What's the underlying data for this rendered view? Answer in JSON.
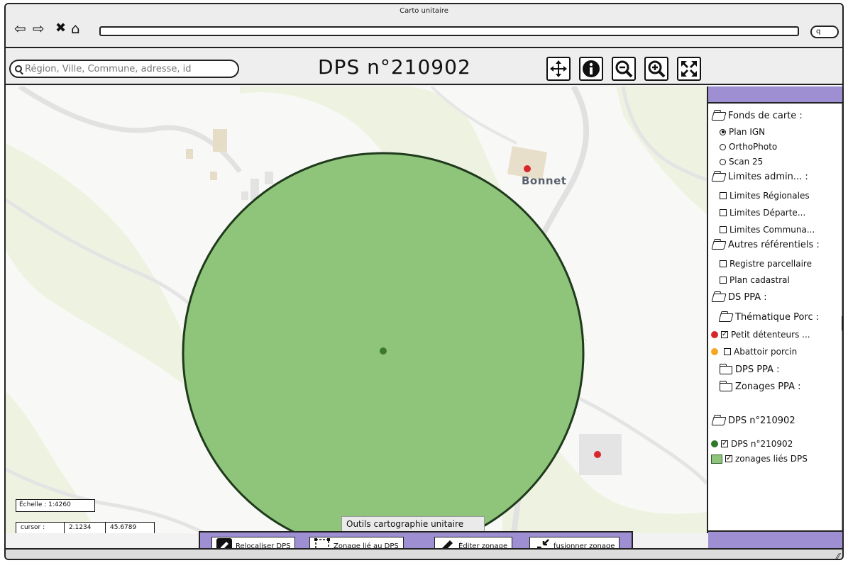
{
  "window": {
    "title": "Carto unitaire"
  },
  "browser": {
    "nav_icons": [
      "back-icon",
      "forward-icon",
      "close-icon",
      "home-icon"
    ],
    "search_glyph": "q"
  },
  "toolbar": {
    "search_placeholder": "Région, Ville, Commune, adresse, id",
    "page_title": "DPS n°210902",
    "tools": [
      "pan-icon",
      "info-icon",
      "zoom-out-icon",
      "zoom-in-icon",
      "fullscreen-icon"
    ]
  },
  "map": {
    "place_label": "Bonnet",
    "scale": "Échelle : 1:4260",
    "cursor_label": "cursor :",
    "cursor_x": "2.1234",
    "cursor_y": "45.6789",
    "colors": {
      "zone_fill": "#8fc57a",
      "zone_stroke": "#1f3a1c",
      "dps_point": "#3a7a2a",
      "detenteur": "#d9262c"
    }
  },
  "tools_panel": {
    "caption": "Outils cartographie unitaire",
    "buttons": [
      {
        "label": "Relocaliser DPS",
        "icon": "pencil-icon"
      },
      {
        "label": "Zonage lié au DPS",
        "icon": "zone-icon"
      },
      {
        "label": "Éditer zonage",
        "icon": "pencil-icon"
      },
      {
        "label": "fusionner zonage",
        "icon": "merge-icon"
      }
    ]
  },
  "layers": {
    "basemaps_title": "Fonds de carte :",
    "basemaps": [
      {
        "label": "Plan IGN",
        "selected": true
      },
      {
        "label": "OrthoPhoto",
        "selected": false
      },
      {
        "label": "Scan 25",
        "selected": false
      }
    ],
    "admin_title": "Limites admin... :",
    "admin": [
      {
        "label": "Limites Régionales",
        "checked": false
      },
      {
        "label": "Limites Départe...",
        "checked": false
      },
      {
        "label": "Limites Communa...",
        "checked": false
      }
    ],
    "other_title": "Autres référentiels :",
    "other": [
      {
        "label": "Registre parcellaire",
        "checked": false
      },
      {
        "label": "Plan cadastral",
        "checked": false
      }
    ],
    "ds_ppa_title": "DS PPA :",
    "thematique_title": "Thématique Porc :",
    "thematique": [
      {
        "label": "Petit détenteurs ...",
        "checked": true,
        "color": "#d9262c"
      },
      {
        "label": "Abattoir porcin",
        "checked": false,
        "color": "#f5a623"
      }
    ],
    "dps_ppa_title": "DPS PPA :",
    "zonages_ppa_title": "Zonages PPA :",
    "dps_title": "DPS n°210902",
    "dps_items": [
      {
        "label": "DPS n°210902",
        "checked": true,
        "color": "#2f7a2a"
      },
      {
        "label": "zonages liés DPS",
        "checked": true,
        "color": "#8fc57a"
      }
    ]
  }
}
